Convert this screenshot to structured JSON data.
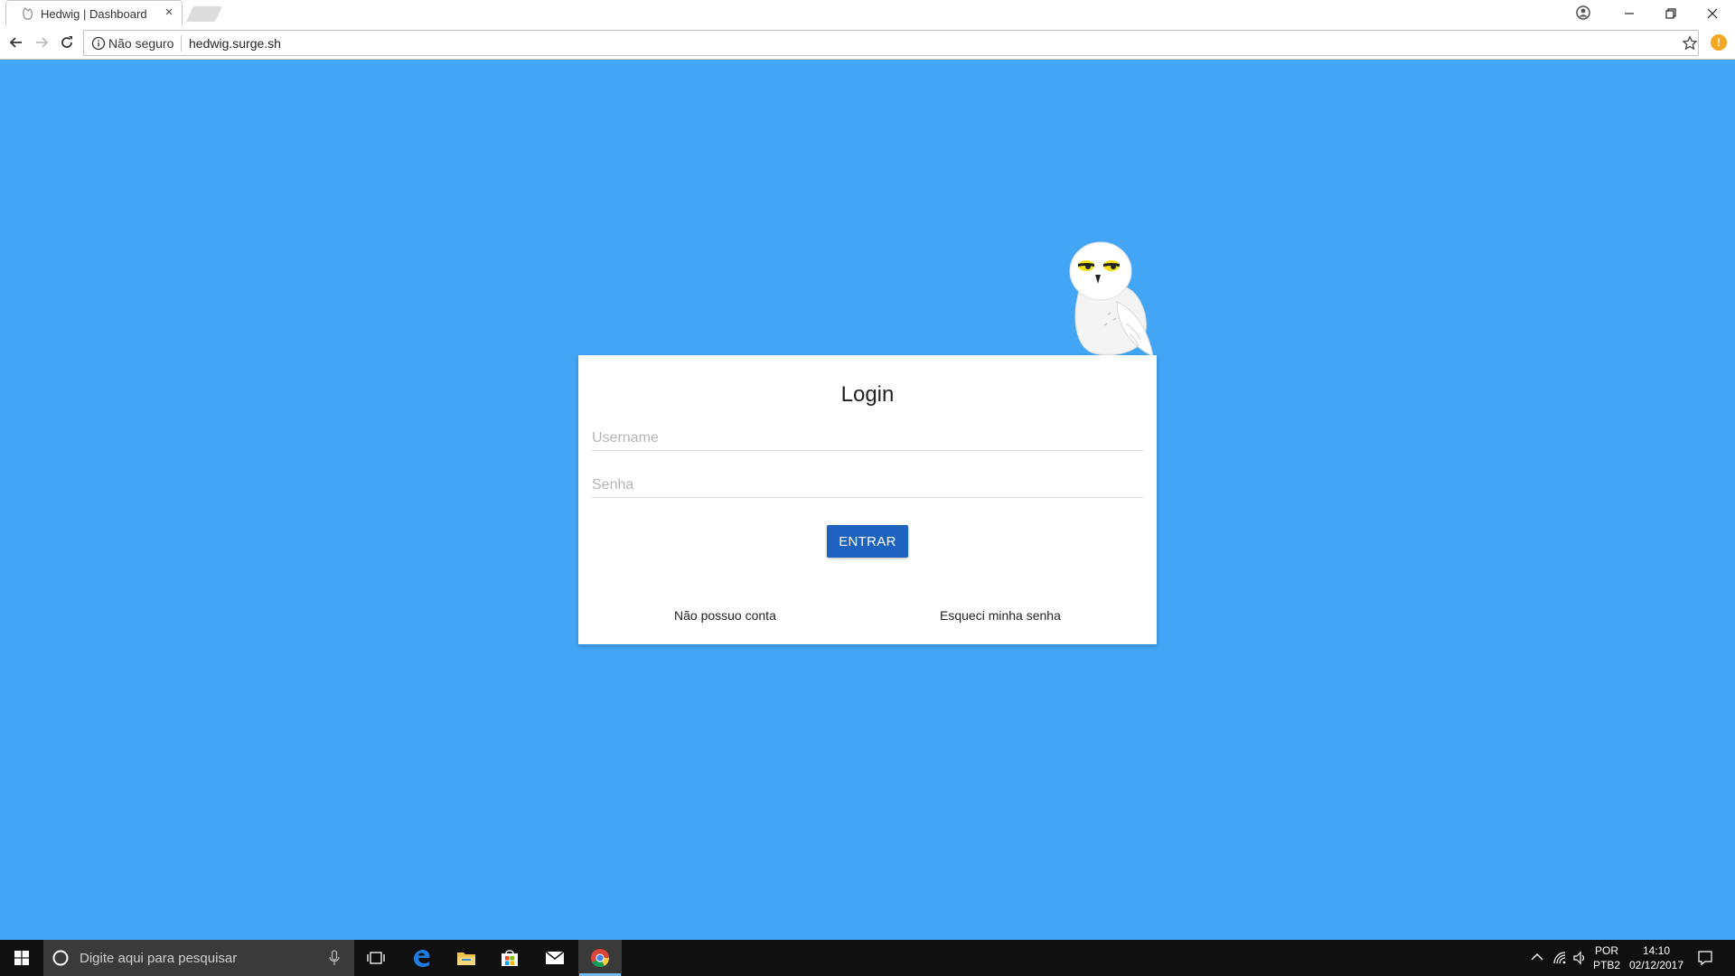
{
  "browser": {
    "tab_title": "Hedwig | Dashboard",
    "tab_close": "×",
    "security_label": "Não seguro",
    "url": "hedwig.surge.sh",
    "extension_badge": "!"
  },
  "login": {
    "title": "Login",
    "username_placeholder": "Username",
    "password_placeholder": "Senha",
    "submit_label": "ENTRAR",
    "no_account_link": "Não possuo conta",
    "forgot_password_link": "Esqueci minha senha"
  },
  "taskbar": {
    "search_placeholder": "Digite aqui para pesquisar",
    "language_top": "POR",
    "language_bottom": "PTB2",
    "time": "14:10",
    "date": "02/12/2017"
  },
  "colors": {
    "background": "#42a5f5",
    "primary_button": "#1e62c0",
    "taskbar": "#101010"
  },
  "icons": [
    "owl-favicon",
    "close-icon",
    "minimize-icon",
    "restore-icon",
    "profile-icon",
    "back-icon",
    "forward-icon",
    "reload-icon",
    "info-icon",
    "star-icon",
    "windows-start-icon",
    "cortana-icon",
    "microphone-icon",
    "task-view-icon",
    "edge-icon",
    "file-explorer-icon",
    "store-icon",
    "mail-icon",
    "chrome-icon",
    "chevron-up-icon",
    "wifi-icon",
    "volume-icon",
    "notification-icon"
  ]
}
